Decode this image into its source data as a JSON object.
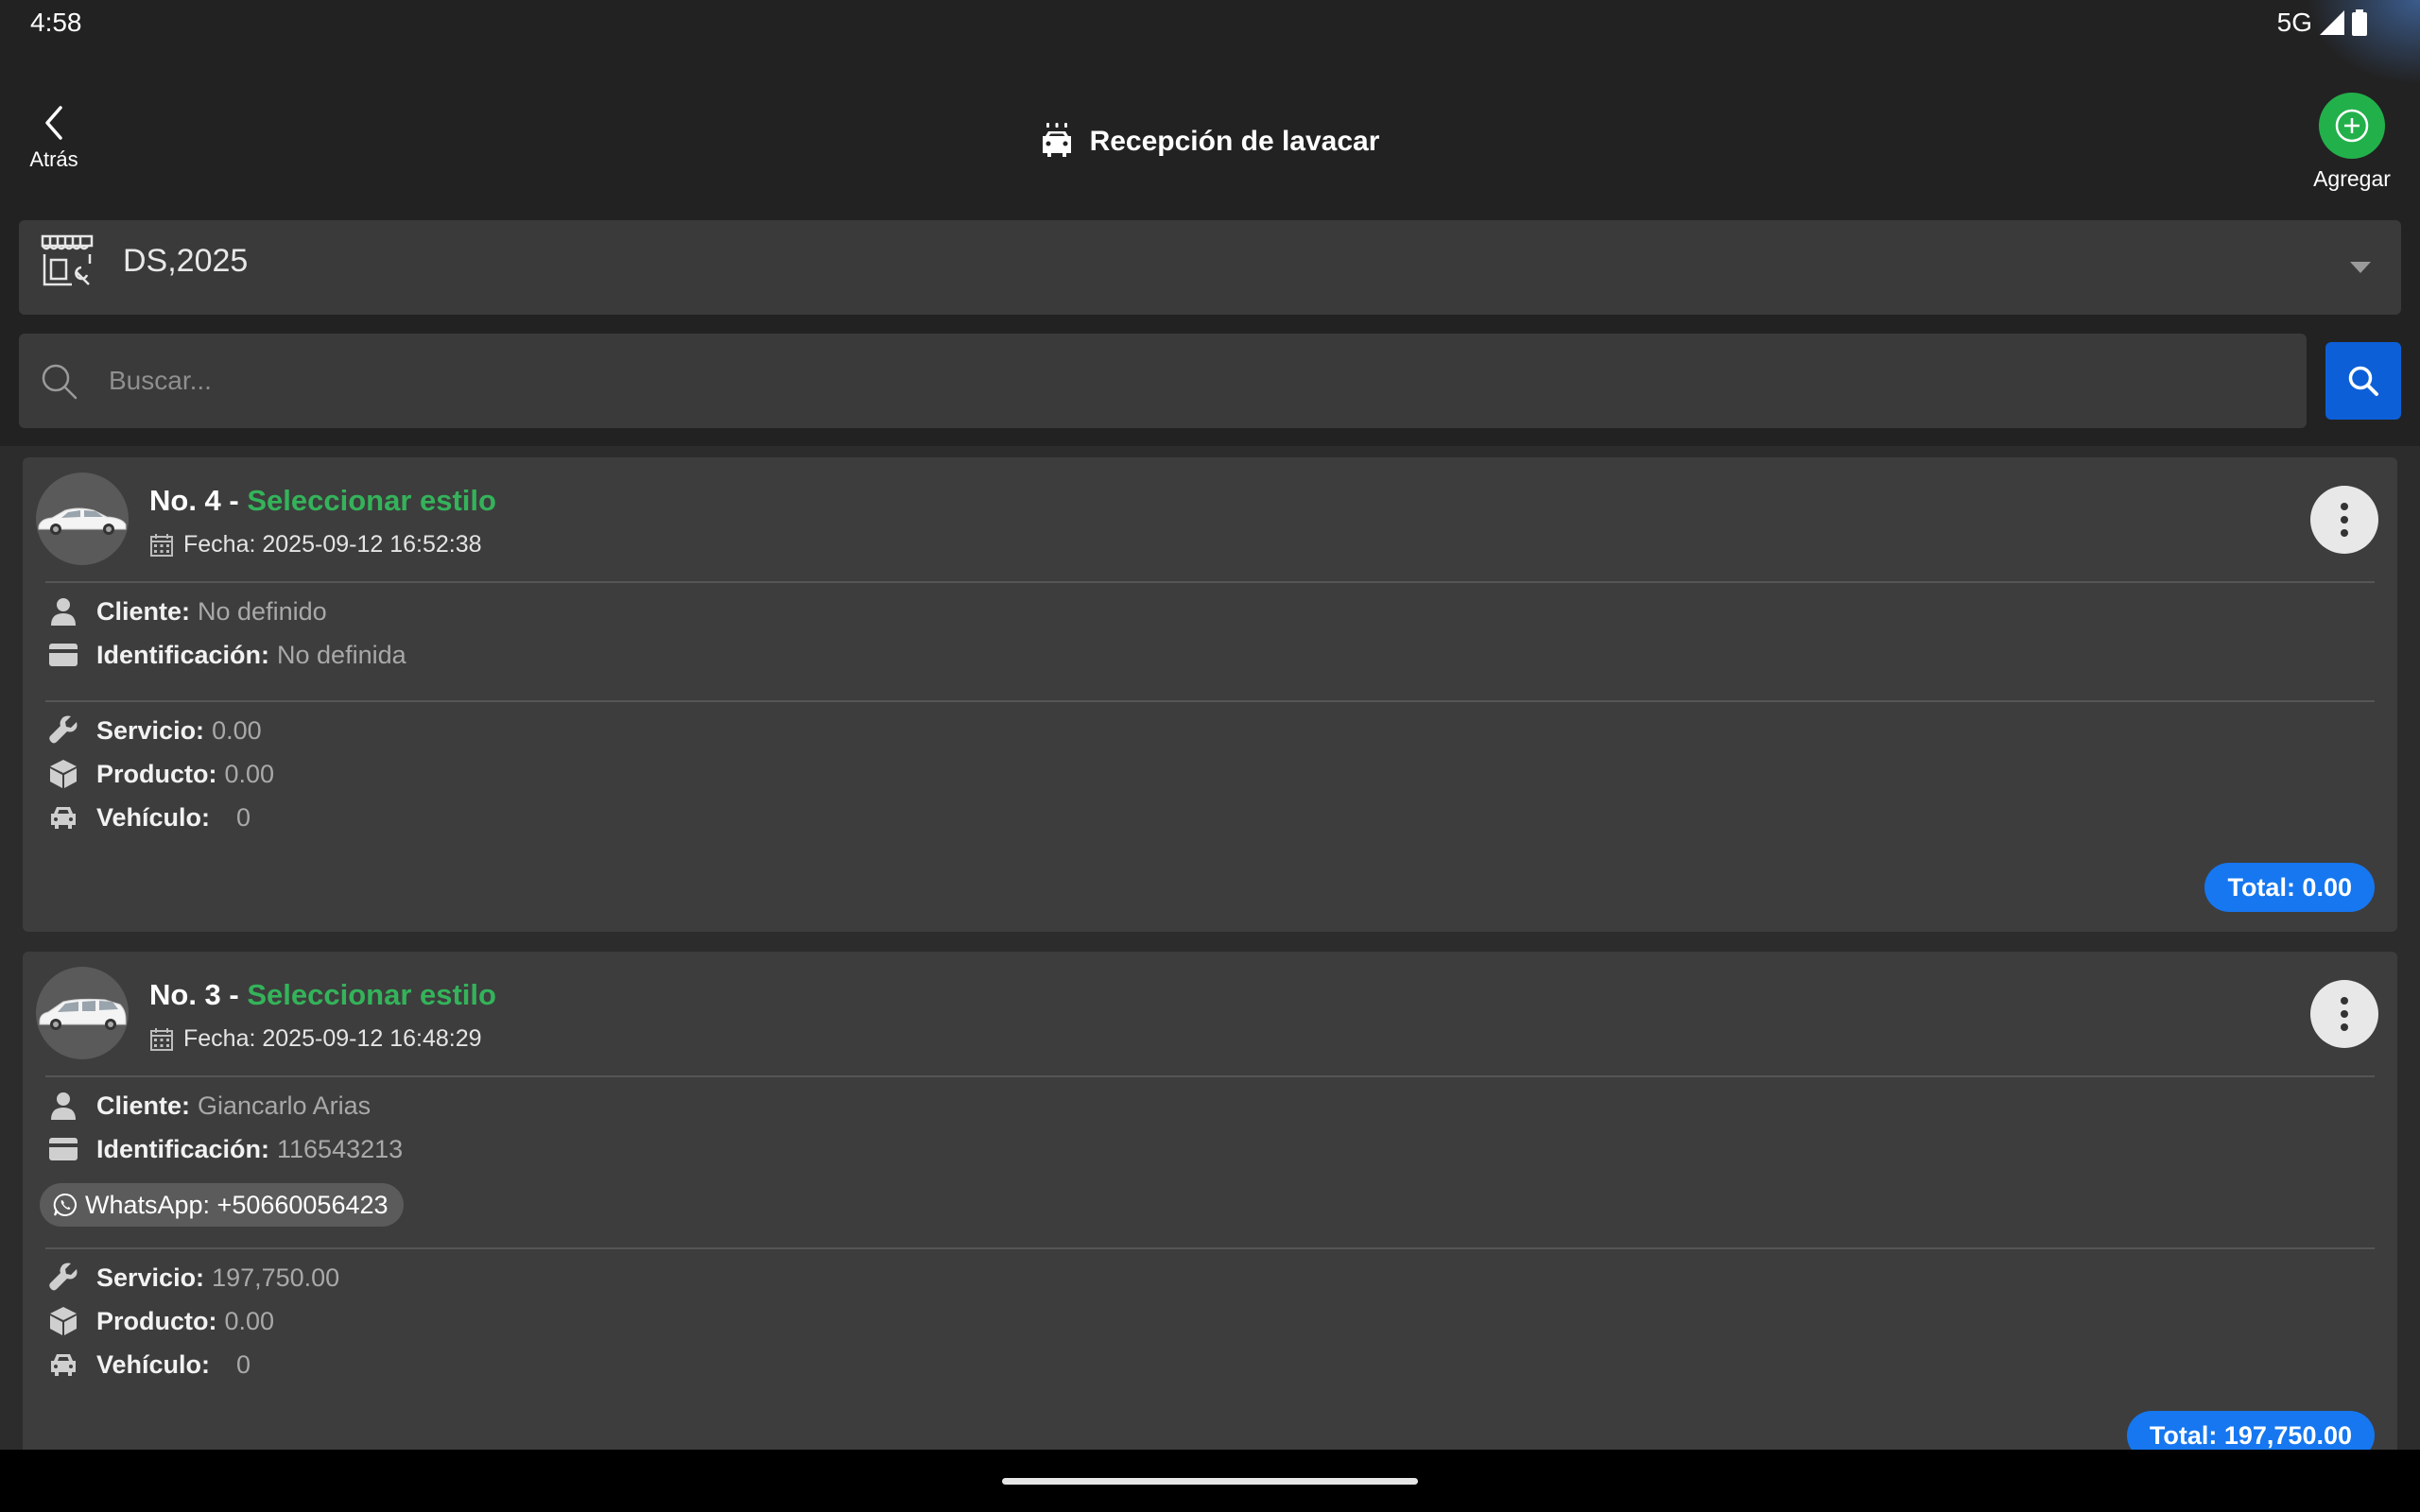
{
  "status_bar": {
    "time": "4:58",
    "network": "5G"
  },
  "header": {
    "back_label": "Atrás",
    "title": "Recepción de lavacar",
    "add_label": "Agregar"
  },
  "branch_selector": {
    "value": "DS,2025"
  },
  "search": {
    "placeholder": "Buscar..."
  },
  "labels": {
    "cliente": "Cliente:",
    "identificacion": "Identificación:",
    "servicio": "Servicio:",
    "producto": "Producto:",
    "vehiculo": "Vehículo:"
  },
  "tickets": [
    {
      "number": "No. 4 - ",
      "style": "Seleccionar estilo",
      "date": "Fecha: 2025-09-12 16:52:38",
      "cliente": "No definido",
      "identificacion": "No definida",
      "servicio": "0.00",
      "producto": "0.00",
      "vehiculo": "0",
      "total": "Total: 0.00"
    },
    {
      "number": "No. 3 - ",
      "style": "Seleccionar estilo",
      "date": "Fecha: 2025-09-12 16:48:29",
      "cliente": "Giancarlo Arias",
      "identificacion": "116543213",
      "whatsapp": "WhatsApp: +50660056423",
      "servicio": "197,750.00",
      "producto": "0.00",
      "vehiculo": "0",
      "total": "Total: 197,750.00"
    }
  ],
  "colors": {
    "accent_green": "#34b35a",
    "accent_blue": "#1677f0",
    "search_button": "#0d5fd8"
  }
}
